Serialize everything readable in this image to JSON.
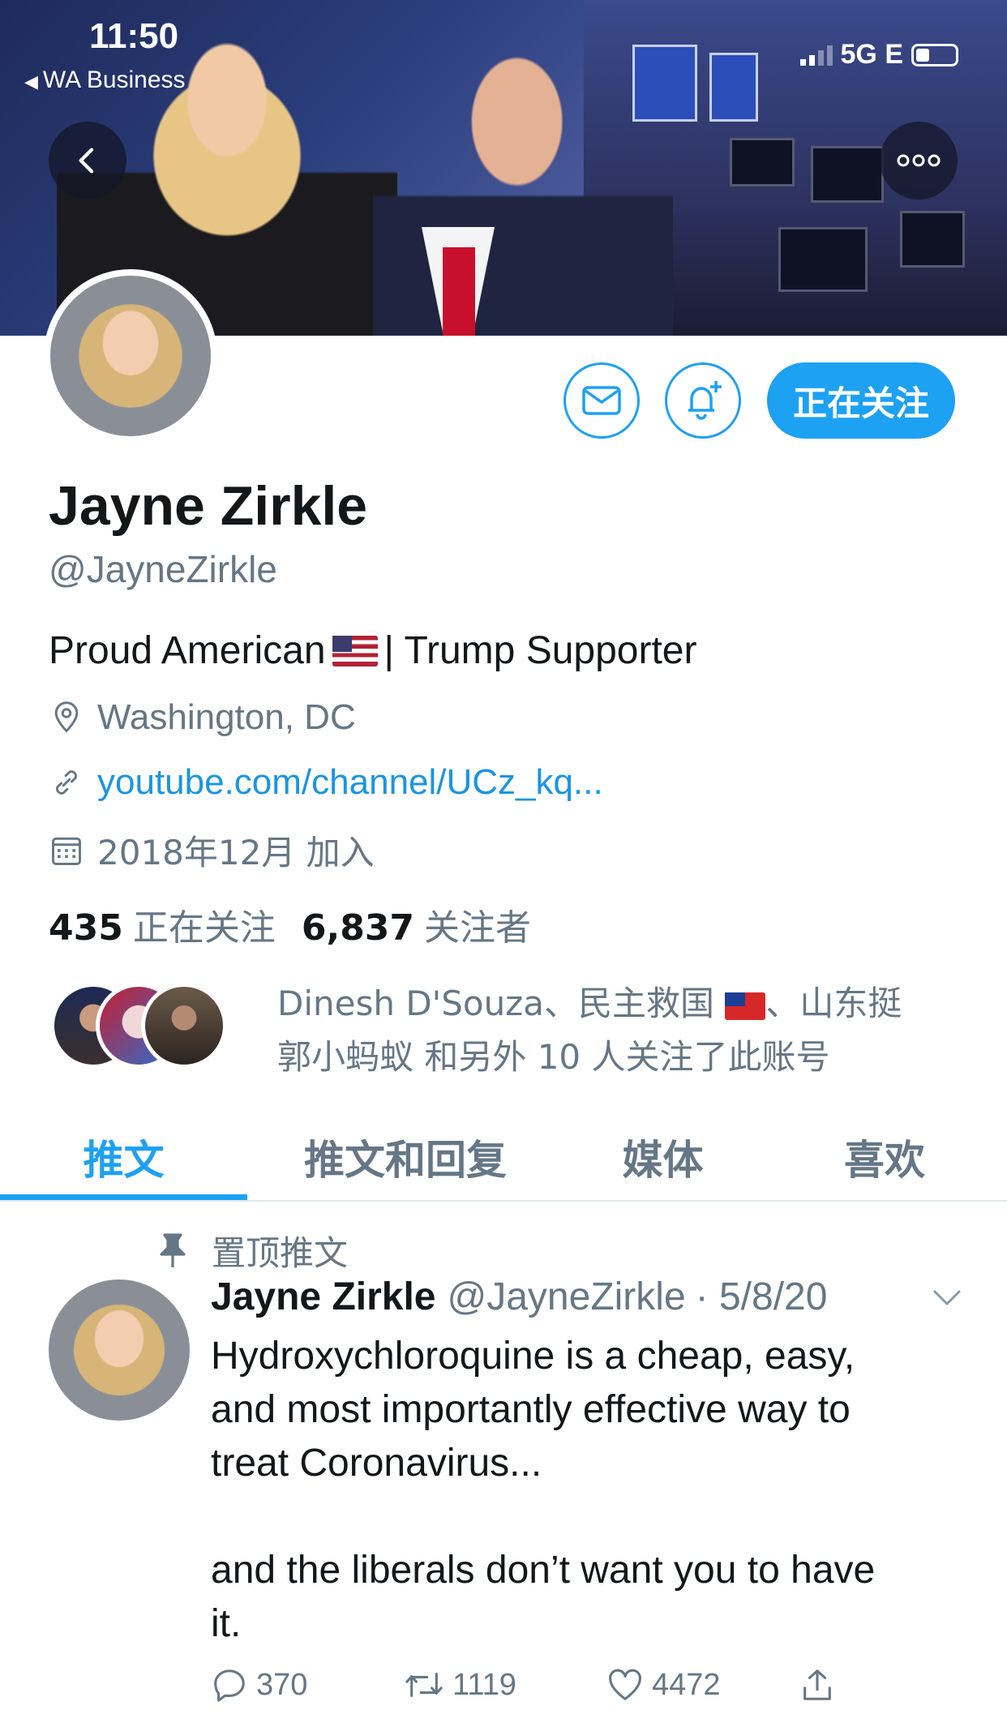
{
  "status_bar": {
    "time": "11:50",
    "back_app": "WA Business",
    "network": "5G E"
  },
  "profile": {
    "name": "Jayne Zirkle",
    "handle": "@JayneZirkle",
    "bio_part1": "Proud American",
    "bio_part2": " | Trump Supporter",
    "location": "Washington, DC",
    "link": "youtube.com/channel/UCz_kq...",
    "joined": "2018年12月 加入",
    "following_count": "435",
    "following_label": "正在关注",
    "followers_count": "6,837",
    "followers_label": "关注者",
    "follow_button": "正在关注"
  },
  "followers_you_know": {
    "line1_a": "Dinesh D'Souza、民主救国 ",
    "line1_b": "、山东挺",
    "line2": "郭小蚂蚁 和另外 10 人关注了此账号"
  },
  "tabs": [
    {
      "label": "推文",
      "active": true
    },
    {
      "label": "推文和回复",
      "active": false
    },
    {
      "label": "媒体",
      "active": false
    },
    {
      "label": "喜欢",
      "active": false
    }
  ],
  "tweet": {
    "pinned_label": "置顶推文",
    "author_name": "Jayne Zirkle",
    "author_handle": "@JayneZirkle",
    "date": "· 5/8/20",
    "text": "Hydroxychloroquine is a cheap, easy,\nand most importantly effective way to\ntreat Coronavirus...\n\nand the liberals don’t want you to have\nit.",
    "replies": "370",
    "retweets": "1119",
    "likes": "4472"
  },
  "colors": {
    "accent": "#1da1f2",
    "link": "#1b95e0",
    "secondary_text": "#657786",
    "primary_text": "#14171a"
  }
}
